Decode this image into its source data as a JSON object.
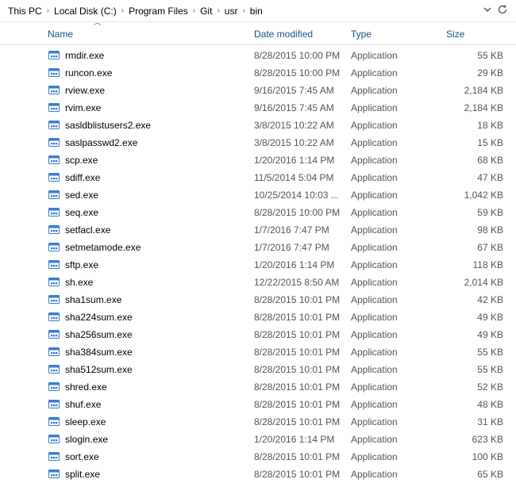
{
  "breadcrumb": {
    "items": [
      "This PC",
      "Local Disk (C:)",
      "Program Files",
      "Git",
      "usr",
      "bin"
    ]
  },
  "columns": {
    "name": "Name",
    "date": "Date modified",
    "type": "Type",
    "size": "Size"
  },
  "files": [
    {
      "name": "rmdir.exe",
      "date": "8/28/2015 10:00 PM",
      "type": "Application",
      "size": "55 KB"
    },
    {
      "name": "runcon.exe",
      "date": "8/28/2015 10:00 PM",
      "type": "Application",
      "size": "29 KB"
    },
    {
      "name": "rview.exe",
      "date": "9/16/2015 7:45 AM",
      "type": "Application",
      "size": "2,184 KB"
    },
    {
      "name": "rvim.exe",
      "date": "9/16/2015 7:45 AM",
      "type": "Application",
      "size": "2,184 KB"
    },
    {
      "name": "sasldblistusers2.exe",
      "date": "3/8/2015 10:22 AM",
      "type": "Application",
      "size": "18 KB"
    },
    {
      "name": "saslpasswd2.exe",
      "date": "3/8/2015 10:22 AM",
      "type": "Application",
      "size": "15 KB"
    },
    {
      "name": "scp.exe",
      "date": "1/20/2016 1:14 PM",
      "type": "Application",
      "size": "68 KB"
    },
    {
      "name": "sdiff.exe",
      "date": "11/5/2014 5:04 PM",
      "type": "Application",
      "size": "47 KB"
    },
    {
      "name": "sed.exe",
      "date": "10/25/2014 10:03 ...",
      "type": "Application",
      "size": "1,042 KB"
    },
    {
      "name": "seq.exe",
      "date": "8/28/2015 10:00 PM",
      "type": "Application",
      "size": "59 KB"
    },
    {
      "name": "setfacl.exe",
      "date": "1/7/2016 7:47 PM",
      "type": "Application",
      "size": "98 KB"
    },
    {
      "name": "setmetamode.exe",
      "date": "1/7/2016 7:47 PM",
      "type": "Application",
      "size": "67 KB"
    },
    {
      "name": "sftp.exe",
      "date": "1/20/2016 1:14 PM",
      "type": "Application",
      "size": "118 KB"
    },
    {
      "name": "sh.exe",
      "date": "12/22/2015 8:50 AM",
      "type": "Application",
      "size": "2,014 KB"
    },
    {
      "name": "sha1sum.exe",
      "date": "8/28/2015 10:01 PM",
      "type": "Application",
      "size": "42 KB"
    },
    {
      "name": "sha224sum.exe",
      "date": "8/28/2015 10:01 PM",
      "type": "Application",
      "size": "49 KB"
    },
    {
      "name": "sha256sum.exe",
      "date": "8/28/2015 10:01 PM",
      "type": "Application",
      "size": "49 KB"
    },
    {
      "name": "sha384sum.exe",
      "date": "8/28/2015 10:01 PM",
      "type": "Application",
      "size": "55 KB"
    },
    {
      "name": "sha512sum.exe",
      "date": "8/28/2015 10:01 PM",
      "type": "Application",
      "size": "55 KB"
    },
    {
      "name": "shred.exe",
      "date": "8/28/2015 10:01 PM",
      "type": "Application",
      "size": "52 KB"
    },
    {
      "name": "shuf.exe",
      "date": "8/28/2015 10:01 PM",
      "type": "Application",
      "size": "48 KB"
    },
    {
      "name": "sleep.exe",
      "date": "8/28/2015 10:01 PM",
      "type": "Application",
      "size": "31 KB"
    },
    {
      "name": "slogin.exe",
      "date": "1/20/2016 1:14 PM",
      "type": "Application",
      "size": "623 KB"
    },
    {
      "name": "sort.exe",
      "date": "8/28/2015 10:01 PM",
      "type": "Application",
      "size": "100 KB"
    },
    {
      "name": "split.exe",
      "date": "8/28/2015 10:01 PM",
      "type": "Application",
      "size": "65 KB"
    }
  ]
}
